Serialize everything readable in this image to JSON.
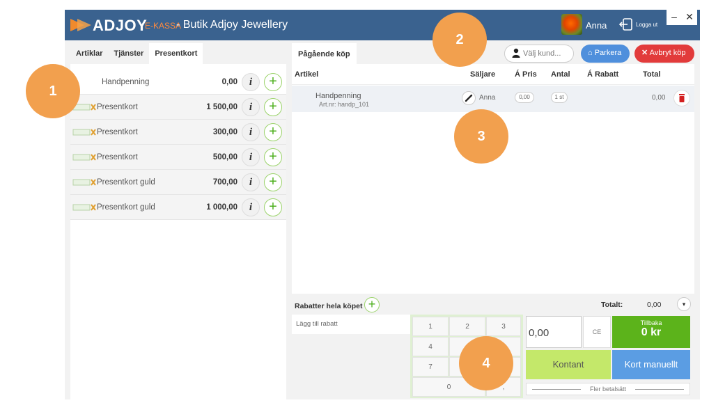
{
  "app": {
    "logo_text": "ADJOY",
    "logo_sub": "E-KASSA",
    "store_title": "-  Butik Adjoy Jewellery",
    "user_name": "Anna",
    "logout_label": "Logga ut",
    "minimize_label": "–",
    "close_label": "✕"
  },
  "left_panel": {
    "tabs": [
      {
        "label": "Artiklar",
        "active": false
      },
      {
        "label": "Tjänster",
        "active": false
      },
      {
        "label": "Presentkort",
        "active": true
      }
    ],
    "products": [
      {
        "name": "Handpenning",
        "price": "0,00",
        "thumb": false
      },
      {
        "name": "Presentkort",
        "price": "1 500,00",
        "thumb": true
      },
      {
        "name": "Presentkort",
        "price": "300,00",
        "thumb": true
      },
      {
        "name": "Presentkort",
        "price": "500,00",
        "thumb": true
      },
      {
        "name": "Presentkort guld",
        "price": "700,00",
        "thumb": true
      },
      {
        "name": "Presentkort guld",
        "price": "1 000,00",
        "thumb": true
      }
    ],
    "info_symbol": "i",
    "add_symbol": "+"
  },
  "cart": {
    "tab_label": "Pågående köp",
    "choose_customer": "Välj kund...",
    "park_label": "Parkera",
    "abort_label": "Avbryt köp",
    "columns": {
      "article": "Artikel",
      "seller": "Säljare",
      "unit_price": "Á Pris",
      "quantity": "Antal",
      "unit_discount": "Á Rabatt",
      "total": "Total"
    },
    "rows": [
      {
        "name": "Handpenning",
        "art_nr": "Art.nr: handp_101",
        "seller": "Anna",
        "price": "0,00",
        "quantity": "1 st",
        "total": "0,00"
      }
    ],
    "discounts_label": "Rabatter hela köpet",
    "total_label": "Totalt:",
    "total_value": "0,00",
    "add_discount_label": "Lägg till rabatt"
  },
  "payment": {
    "keys": [
      "1",
      "2",
      "3",
      "4",
      "7",
      "0",
      ","
    ],
    "amount": "0,00",
    "ce_label": "CE",
    "change_label": "Tillbaka",
    "change_value": "0 kr",
    "cash_label": "Kontant",
    "card_label": "Kort manuellt",
    "more_methods_label": "Fler betalsätt"
  },
  "callouts": [
    "1",
    "2",
    "3",
    "4"
  ],
  "colors": {
    "titlebar": "#3a628f",
    "accent_orange": "#f2a04e",
    "park_blue": "#4f8fdc",
    "abort_red": "#e23b3b",
    "change_green": "#5cb31b",
    "cash_lime": "#c4e86a",
    "card_blue": "#5b9de3"
  }
}
